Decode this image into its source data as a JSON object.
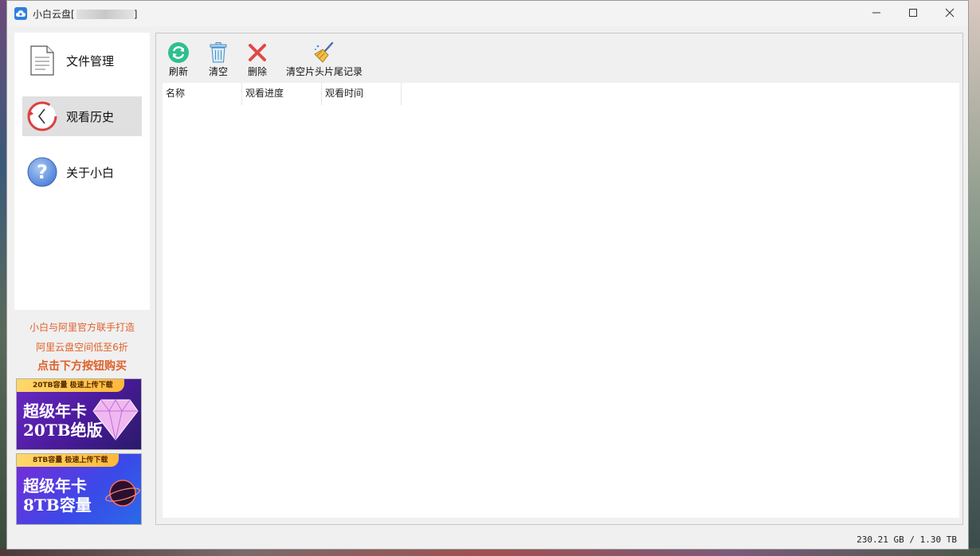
{
  "window": {
    "title": "小白云盘[",
    "title_suffix": "]",
    "controls": [
      "minimize-icon",
      "maximize-icon",
      "close-icon"
    ]
  },
  "sidebar": {
    "items": [
      {
        "label": "文件管理",
        "icon": "document-icon",
        "active": false
      },
      {
        "label": "观看历史",
        "icon": "history-clock-icon",
        "active": true
      },
      {
        "label": "关于小白",
        "icon": "help-icon",
        "active": false
      }
    ]
  },
  "promo": {
    "line1": "小白与阿里官方联手打造",
    "line2": "阿里云盘空间低至6折",
    "line3": "点击下方按钮购买",
    "ads": [
      {
        "strip": "20TB容量 极速上传下载",
        "title1": "超级年卡",
        "title2": "20TB绝版"
      },
      {
        "strip": "8TB容量 极速上传下载",
        "title1": "超级年卡",
        "title2": "8TB容量"
      }
    ]
  },
  "toolbar": {
    "refresh_label": "刷新",
    "clear_label": "清空",
    "delete_label": "删除",
    "clear_intro_outro_label": "清空片头片尾记录"
  },
  "history_table": {
    "columns": [
      "名称",
      "观看进度",
      "观看时间"
    ],
    "rows": []
  },
  "status": {
    "storage": "230.21 GB / 1.30 TB"
  },
  "colors": {
    "promo_orange": "#e0602a",
    "active_nav_bg": "#e0e0e0",
    "refresh_green": "#2fbf8f",
    "delete_red": "#e04848"
  }
}
